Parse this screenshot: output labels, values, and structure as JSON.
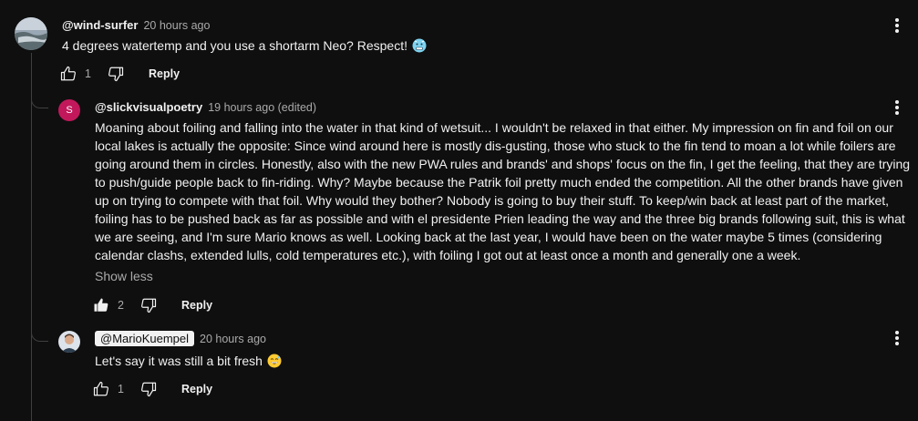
{
  "comments": [
    {
      "author": "@wind-surfer",
      "time": "20 hours ago",
      "text": "4 degrees watertemp and you use a shortarm Neo?  Respect!",
      "likes": "1",
      "reply_label": "Reply",
      "emoji_icon": "cold-face-icon"
    },
    {
      "author": "@slickvisualpoetry",
      "avatar_letter": "S",
      "avatar_color": "#c2185b",
      "time": "19 hours ago (edited)",
      "text": "Moaning about foiling and falling into the water in that kind of wetsuit... I wouldn't be relaxed in that either. My impression on fin and foil on our local lakes is actually the opposite: Since wind around here is mostly dis-gusting, those who stuck to the fin tend to moan a lot while foilers are going around them in circles. Honestly, also with the new PWA rules and brands' and shops' focus on the fin, I get the feeling, that they are trying to push/guide people back to fin-riding. Why? Maybe because the Patrik foil pretty much ended the competition. All the other brands have given up on trying to compete with that foil. Why would they bother? Nobody is going to buy their stuff. To keep/win back at least part of the market, foiling has to be pushed back as far as possible and with el presidente Prien leading the way and the three big brands following suit, this is what we are seeing, and I'm sure Mario knows as well. Looking back at the last year, I would have been on the water maybe 5 times (considering calendar clashs, extended lulls, cold temperatures etc.), with foiling I got out at least once a month and generally one a week.",
      "show_less": "Show less",
      "likes": "2",
      "reply_label": "Reply",
      "liked": true
    },
    {
      "author": "@MarioKuempel",
      "time": "20 hours ago",
      "text": "Let's say it was still a bit fresh",
      "likes": "1",
      "reply_label": "Reply",
      "emoji_icon": "grinning-sweat-face-icon"
    }
  ]
}
